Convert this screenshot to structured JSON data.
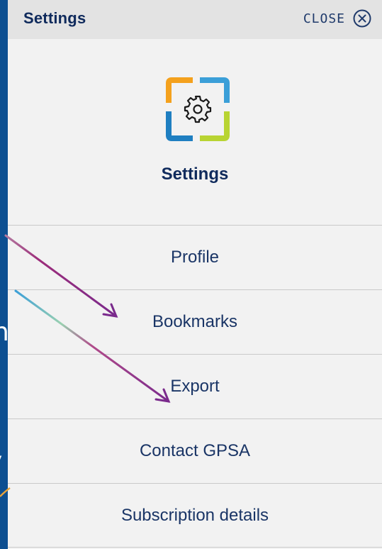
{
  "background": {
    "text_1": "nts",
    "text_2": "y"
  },
  "header": {
    "title": "Settings",
    "close_label": "CLOSE",
    "close_icon": "close-circle-icon"
  },
  "hero": {
    "icon": "settings-gear-icon",
    "title": "Settings"
  },
  "menu": {
    "items": [
      {
        "label": "Profile"
      },
      {
        "label": "Bookmarks"
      },
      {
        "label": "Export"
      },
      {
        "label": "Contact GPSA"
      },
      {
        "label": "Subscription details"
      }
    ]
  },
  "colors": {
    "panel_bg": "#f2f2f2",
    "header_bg": "#e3e3e3",
    "text_dark_blue": "#0f2a5c",
    "background_blue": "#0d4f91",
    "arrow_purple": "#7a2a8c",
    "logo_orange": "#f4a11d",
    "logo_blue": "#3b9fd8",
    "logo_green": "#b8d432"
  }
}
